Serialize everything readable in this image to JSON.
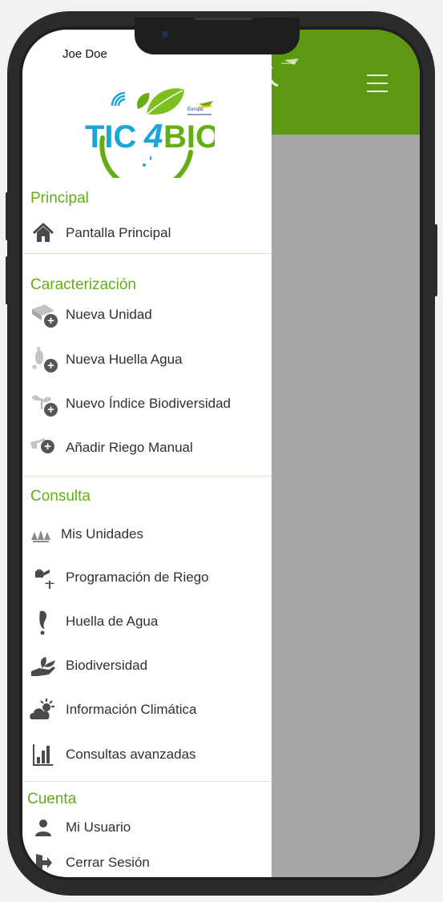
{
  "user": {
    "name": "Joe Doe"
  },
  "logo": {
    "text_tic": "TIC",
    "text_4": "4",
    "text_bio": "BIO",
    "badge": "Europa"
  },
  "sections": {
    "principal": {
      "title": "Principal",
      "items": [
        {
          "label": "Pantalla Principal",
          "icon": "home-icon"
        }
      ]
    },
    "caracterizacion": {
      "title": "Caracterización",
      "items": [
        {
          "label": "Nueva Unidad",
          "icon": "new-unit-icon"
        },
        {
          "label": "Nueva Huella Agua",
          "icon": "new-water-footprint-icon"
        },
        {
          "label": "Nuevo Índice Biodiversidad",
          "icon": "new-biodiversity-icon"
        },
        {
          "label": "Añadir Riego Manual",
          "icon": "add-manual-irrigation-icon"
        }
      ]
    },
    "consulta": {
      "title": "Consulta",
      "items": [
        {
          "label": "Mis Unidades",
          "icon": "units-icon"
        },
        {
          "label": "Programación de Riego",
          "icon": "watering-can-icon"
        },
        {
          "label": "Huella de Agua",
          "icon": "footprint-icon"
        },
        {
          "label": "Biodiversidad",
          "icon": "sprout-hand-icon"
        },
        {
          "label": "Información Climática",
          "icon": "weather-icon"
        },
        {
          "label": "Consultas avanzadas",
          "icon": "bar-chart-icon"
        }
      ]
    },
    "cuenta": {
      "title": "Cuenta",
      "items": [
        {
          "label": "Mi Usuario",
          "icon": "user-icon"
        },
        {
          "label": "Cerrar Sesión",
          "icon": "logout-icon"
        }
      ]
    }
  },
  "colors": {
    "accent": "#63ae13",
    "header": "#5d9812",
    "overlay": "#a6a6a6",
    "logo_blue": "#1aa6d8"
  }
}
